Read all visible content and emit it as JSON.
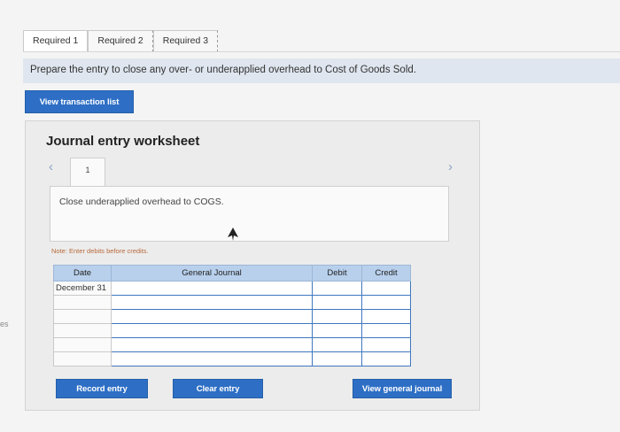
{
  "edge_text": "es",
  "tabs": [
    {
      "label": "Required 1"
    },
    {
      "label": "Required 2"
    },
    {
      "label": "Required 3"
    }
  ],
  "instruction": "Prepare the entry to close any over- or underapplied overhead to Cost of Goods Sold.",
  "buttons": {
    "view_transaction_list": "View transaction list",
    "record_entry": "Record entry",
    "clear_entry": "Clear entry",
    "view_general_journal": "View general journal"
  },
  "worksheet": {
    "title": "Journal entry worksheet",
    "entry_number": "1",
    "description": "Close underapplied overhead to COGS.",
    "note": "Note: Enter debits before credits.",
    "prev_icon": "chevron-left-icon",
    "next_icon": "chevron-right-icon"
  },
  "journal": {
    "headers": {
      "date": "Date",
      "account": "General Journal",
      "debit": "Debit",
      "credit": "Credit"
    },
    "rows": [
      {
        "date": "December 31",
        "account": "",
        "debit": "",
        "credit": ""
      },
      {
        "date": "",
        "account": "",
        "debit": "",
        "credit": ""
      },
      {
        "date": "",
        "account": "",
        "debit": "",
        "credit": ""
      },
      {
        "date": "",
        "account": "",
        "debit": "",
        "credit": ""
      },
      {
        "date": "",
        "account": "",
        "debit": "",
        "credit": ""
      },
      {
        "date": "",
        "account": "",
        "debit": "",
        "credit": ""
      }
    ]
  },
  "colors": {
    "accent": "#2e6fc5",
    "header_fill": "#b8d0ec",
    "instruction_fill": "#dfe6ef"
  }
}
